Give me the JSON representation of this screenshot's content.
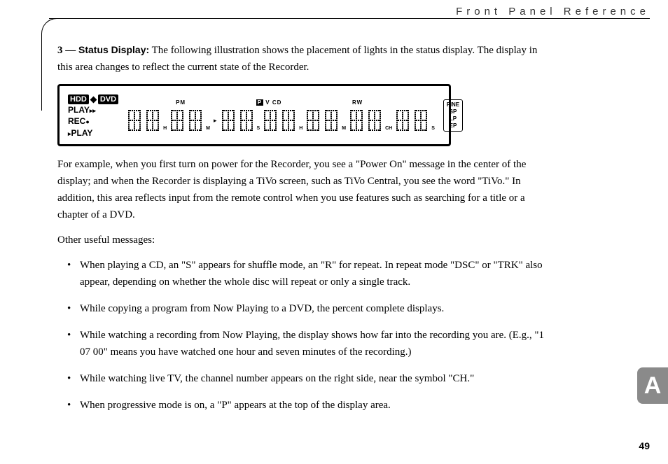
{
  "header": {
    "title": "Front Panel Reference"
  },
  "section": {
    "number": "3",
    "dash": "—",
    "label": "Status Display:",
    "intro": " The following illustration shows the placement of lights in the status display. The display in this area changes to reflect the current state of the Recorder."
  },
  "status_display": {
    "left": {
      "hdd": "HDD",
      "dvd": "DVD",
      "play_label": "PLAY",
      "play_symbols": "▸▸",
      "rec_label": "REC",
      "rec_dot": "●",
      "play2_tri": "▸",
      "play2_label": "PLAY"
    },
    "top_row": {
      "pm": "PM",
      "p": "P",
      "v": "V",
      "cd": "CD",
      "rw": "RW"
    },
    "suffix": {
      "h": "H",
      "m": "M",
      "s": "S",
      "ch": "CH"
    },
    "quality": [
      "FINE",
      "SP",
      "LP",
      "EP"
    ]
  },
  "body": {
    "example": "For example, when you first turn on power for the Recorder, you see a \"Power On\" message in the center of the display; and when the Recorder is displaying a TiVo screen, such as TiVo Central, you see the word \"TiVo.\" In addition, this area reflects input from the remote control when you use features such as searching for a title or a chapter of a DVD.",
    "other_label": "Other useful messages:",
    "bullets": [
      "When playing a CD, an \"S\" appears for shuffle mode, an \"R\" for repeat. In repeat mode \"DSC\" or \"TRK\" also appear, depending on whether the whole disc will repeat or only a single track.",
      "While copying a program from Now Playing to a DVD, the percent complete displays.",
      "While watching a recording from Now Playing, the display shows how far into the recording you are. (E.g., \"1 07 00\" means you have watched one hour and seven minutes of the recording.)",
      "While watching live TV, the channel number appears on the right side, near the symbol \"CH.\"",
      "When progressive mode is on, a \"P\" appears at the top of the display area."
    ]
  },
  "side_tab": "A",
  "page_number": "49"
}
